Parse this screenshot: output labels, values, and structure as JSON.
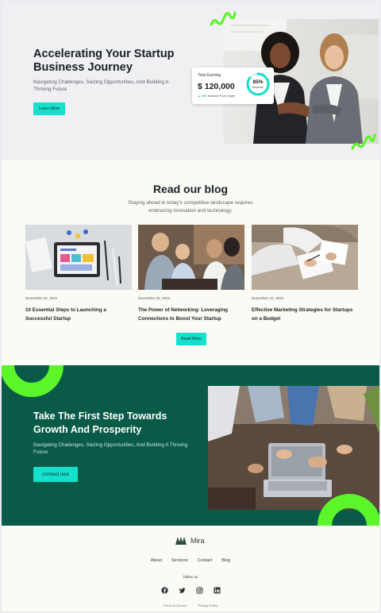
{
  "hero": {
    "title": "Accelerating Your Startup Business Journey",
    "subtitle": "Navigating Challenges, Seizing Opportunities, And Building A Thriving Future",
    "button": "Learn More",
    "accent": "#16e0cc",
    "squiggle_color": "#5cf52a"
  },
  "earning_card": {
    "label": "Total Earning",
    "amount": "$ 120,000",
    "note_strong": "12%",
    "note_rest": " increase From Target",
    "ring_percent": "85%",
    "ring_label": "Revenue",
    "ring_value": 0.85
  },
  "blog": {
    "title": "Read our blog",
    "subtitle": "Staying ahead in today's competitive landscape requires embracing innovation and technology.",
    "button": "Read More",
    "posts": [
      {
        "date": "November 22, 2021",
        "title": "10 Essential Steps to Launching a Successful Startup",
        "image": "tablet-and-pens-photo"
      },
      {
        "date": "November 22, 2021",
        "title": "The Power of Networking: Leveraging Connections to Boost Your Startup",
        "image": "networking-group-photo"
      },
      {
        "date": "November 22, 2021",
        "title": "Effective Marketing Strategies for Startups on a Budget",
        "image": "paperwork-hands-photo"
      }
    ]
  },
  "cta": {
    "title": "Take The First Step Towards Growth And Prosperity",
    "subtitle": "Navigating Challenges, Seizing Opportunities, And Building A Thriving Future",
    "button": "connect now",
    "background": "#0a5a48"
  },
  "footer": {
    "logo": "Mira",
    "nav": [
      "About",
      "Services",
      "Contact",
      "Blog"
    ],
    "follow_label": "follow us",
    "socials": [
      "facebook-icon",
      "twitter-icon",
      "instagram-icon",
      "linkedin-icon"
    ],
    "legal": [
      "Terms of Service",
      "Privacy Policy"
    ]
  }
}
